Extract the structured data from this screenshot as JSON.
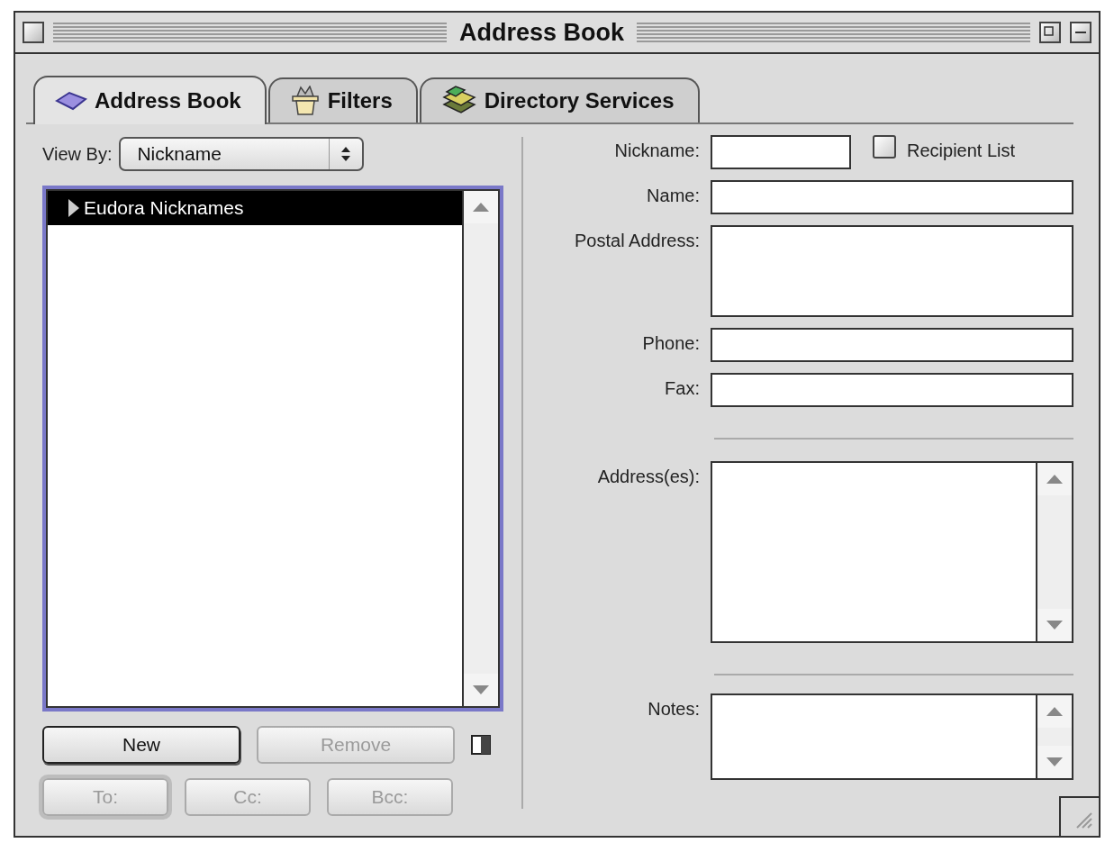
{
  "window": {
    "title": "Address Book"
  },
  "tabs": [
    {
      "label": "Address Book",
      "selected": true
    },
    {
      "label": "Filters",
      "selected": false
    },
    {
      "label": "Directory Services",
      "selected": false
    }
  ],
  "view_by": {
    "label": "View By:",
    "value": "Nickname"
  },
  "list": {
    "focused": true,
    "items": [
      {
        "label": "Eudora Nicknames",
        "selected": true,
        "expanded": false
      }
    ]
  },
  "list_buttons": [
    {
      "label": "New",
      "disabled": false,
      "default": false
    },
    {
      "label": "Remove",
      "disabled": true,
      "default": false
    }
  ],
  "recipient_buttons": [
    {
      "label": "To:",
      "disabled": true,
      "default": true
    },
    {
      "label": "Cc:",
      "disabled": true,
      "default": false
    },
    {
      "label": "Bcc:",
      "disabled": true,
      "default": false
    }
  ],
  "nickname": {
    "label": "Nickname:"
  },
  "recipient_list": {
    "label": "Recipient List",
    "checked": false
  },
  "fields": [
    {
      "label": "Name:",
      "kind": "line"
    },
    {
      "label": "Postal Address:",
      "kind": "area"
    },
    {
      "label": "Phone:",
      "kind": "line"
    },
    {
      "label": "Fax:",
      "kind": "line"
    },
    {
      "label": "Address(es):",
      "kind": "scroll"
    },
    {
      "label": "Notes:",
      "kind": "scroll"
    }
  ]
}
